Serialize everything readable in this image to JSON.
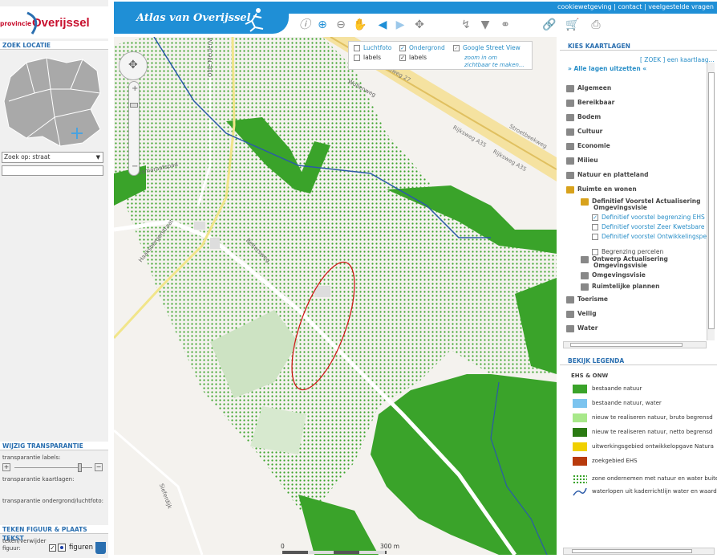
{
  "header": {
    "title": "Atlas van Overijssel",
    "logo_small": "provincie",
    "logo_big": "Overijssel",
    "links": [
      "cookiewetgeving",
      "contact",
      "veelgestelde vragen"
    ]
  },
  "toolbar_icons": [
    "info-icon",
    "zoom-in-icon",
    "zoom-out-icon",
    "pan-hand-icon",
    "back-icon",
    "forward-icon",
    "full-extent-icon",
    "measure-icon",
    "filter-icon",
    "layers-icon",
    "link-icon",
    "cart-icon",
    "print-icon"
  ],
  "left": {
    "zoek_title": "ZOEK LOCATIE",
    "zoek_select": "Zoek op: straat",
    "transparantie_title": "WIJZIG TRANSPARANTIE",
    "trans_labels": "transparantie labels:",
    "trans_kaartlagen": "transparantie kaartlagen:",
    "trans_ondergrond": "transparantie ondergrond/luchtfoto:",
    "teken_title": "TEKEN FIGUUR & PLAATS TEKST",
    "teken_line1": "teken/verwijder",
    "teken_line2": "figuur:",
    "figuren": "figuren"
  },
  "map_overlay": {
    "luchtfoto": "Luchtfoto",
    "labels1": "labels",
    "ondergrond": "Ondergrond",
    "labels2": "labels",
    "streetview": "Google Street View",
    "zoom_line1": "zoom in om",
    "zoom_line2": "zichtbaar te maken...",
    "scale_0": "0",
    "scale_300": "300 m",
    "roads": [
      "Olde Meulenweg",
      "Wullenweg",
      "Rijksweg A35",
      "Rijksweg A35",
      "Stroetbeekweg",
      "Rijksweg 27",
      "Esmaraatspad",
      "Haaksbergerstraat",
      "Beltersweg",
      "Sieferdijk"
    ]
  },
  "right": {
    "kaartlagen_title": "KIES KAARTLAGEN",
    "zoek_link": "[ ZOEK ]",
    "zoek_after": "een kaartlaag...",
    "alle_lagen": "» Alle lagen uitzetten «",
    "layers": [
      "Algemeen",
      "Bereikbaar",
      "Bodem",
      "Cultuur",
      "Economie",
      "Milieu",
      "Natuur en platteland",
      "Ruimte en wonen"
    ],
    "sub_folder_line1": "Definitief Voorstel Actualisering",
    "sub_folder_line2": "Omgevingsvisie",
    "sub_items": [
      "Definitief voorstel begrenzing EHS",
      "Definitief voorstel Zeer Kwetsbare",
      "Definitief voorstel Ontwikkelingsper"
    ],
    "begrenzing": "Begrenzing percelen",
    "ontwerp_line1": "Ontwerp Actualisering",
    "ontwerp_line2": "Omgevingsvisie",
    "omgevingsvisie": "Omgevingsvisie",
    "ruimtelijke": "Ruimtelijke plannen",
    "more_layers": [
      "Toerisme",
      "Veilig",
      "Water"
    ],
    "legenda_title": "BEKIJK LEGENDA",
    "legenda_group": "EHS & ONW",
    "legend": [
      {
        "label": "bestaande natuur",
        "color": "#3aa32a"
      },
      {
        "label": "bestaande natuur, water",
        "color": "#7cc4ef"
      },
      {
        "label": "nieuw te realiseren natuur, bruto begrensd",
        "color": "#a8e88a"
      },
      {
        "label": "nieuw te realiseren natuur, netto begrensd",
        "color": "#2a7a12"
      },
      {
        "label": "uitwerkingsgebied ontwikkelopgave Natura",
        "color": "#f0d000"
      },
      {
        "label": "zoekgebied EHS",
        "color": "#b83a0c"
      },
      {
        "label": "zone ondernemen met natuur en water buiten",
        "color": "#3aa32a"
      },
      {
        "label": "waterlopen uit kaderrichtlijn water en waarde",
        "color": "#2b5aa8"
      }
    ]
  }
}
